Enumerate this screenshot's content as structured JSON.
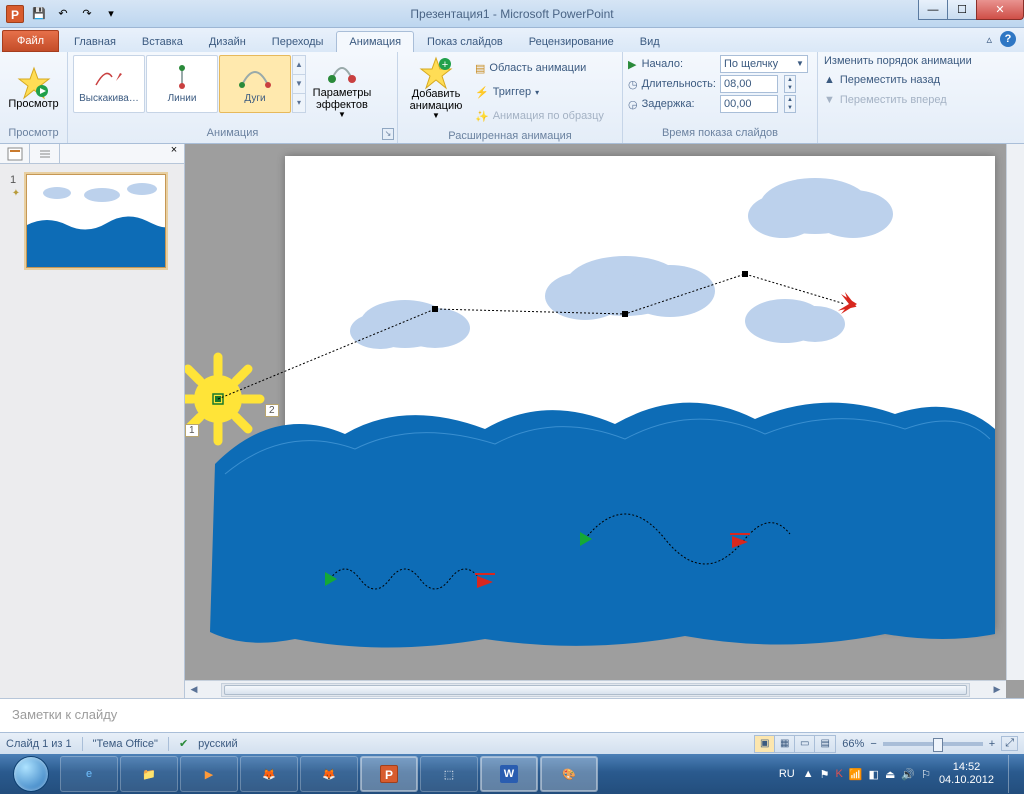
{
  "window": {
    "title": "Презентация1 - Microsoft PowerPoint"
  },
  "qat": {
    "save": "💾",
    "undo": "↶",
    "redo": "↷"
  },
  "win": {
    "min": "—",
    "max": "☐",
    "close": "✕"
  },
  "tabs": {
    "file": "Файл",
    "items": [
      "Главная",
      "Вставка",
      "Дизайн",
      "Переходы",
      "Анимация",
      "Показ слайдов",
      "Рецензирование",
      "Вид"
    ],
    "active": "Анимация",
    "minimize": "▵",
    "help": "?"
  },
  "ribbon": {
    "preview": {
      "label": "Просмотр",
      "btn": "Просмотр"
    },
    "animation": {
      "label": "Анимация",
      "gallery": [
        {
          "name": "Выскакива…"
        },
        {
          "name": "Линии"
        },
        {
          "name": "Дуги",
          "selected": true
        }
      ],
      "effect_options": "Параметры\nэффектов"
    },
    "advanced": {
      "label": "Расширенная анимация",
      "add": "Добавить\nанимацию",
      "pane": "Область анимации",
      "trigger": "Триггер",
      "painter": "Анимация по образцу"
    },
    "timing": {
      "label": "Время показа слайдов",
      "start_lbl": "Начало:",
      "start_val": "По щелчку",
      "duration_lbl": "Длительность:",
      "duration_val": "08,00",
      "delay_lbl": "Задержка:",
      "delay_val": "00,00"
    },
    "reorder": {
      "title": "Изменить порядок анимации",
      "earlier": "Переместить назад",
      "later": "Переместить вперед"
    }
  },
  "thumbnails": {
    "close": "×",
    "slide_num": "1",
    "star": "✦"
  },
  "slide": {
    "anim_tags": [
      "1",
      "2"
    ]
  },
  "notes": {
    "placeholder": "Заметки к слайду"
  },
  "status": {
    "slide": "Слайд 1 из 1",
    "theme": "\"Тема Office\"",
    "lang": "русский",
    "zoom": "66%"
  },
  "taskbar": {
    "lang": "RU",
    "time": "14:52",
    "date": "04.10.2012"
  }
}
